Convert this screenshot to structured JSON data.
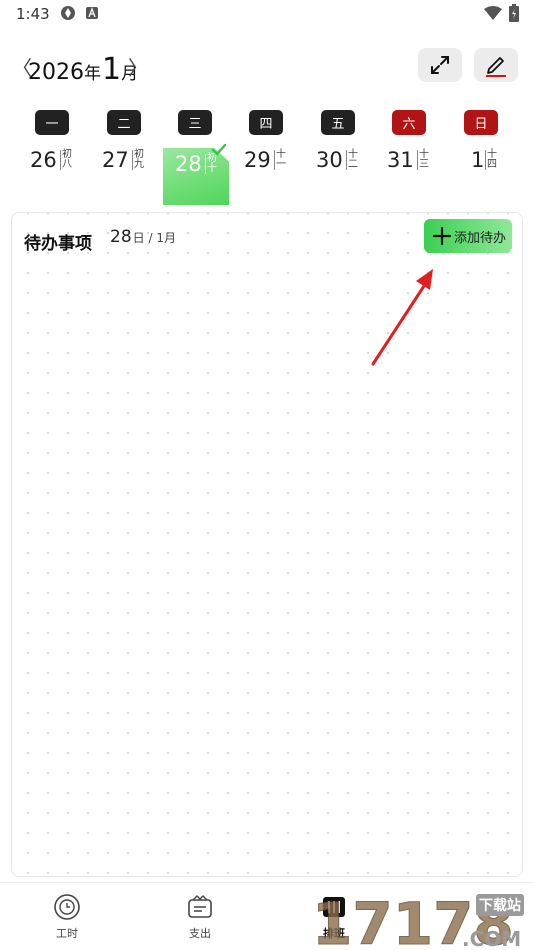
{
  "status_bar": {
    "time": "1:43"
  },
  "header": {
    "year": "2026",
    "year_suffix": "年",
    "month": "1",
    "month_suffix": "月",
    "prev_glyph": "〈",
    "next_glyph": "〉"
  },
  "week": {
    "days": [
      {
        "weekday": "一",
        "date": "26",
        "lunar": "初八",
        "weekend": false,
        "selected": false
      },
      {
        "weekday": "二",
        "date": "27",
        "lunar": "初九",
        "weekend": false,
        "selected": false
      },
      {
        "weekday": "三",
        "date": "28",
        "lunar": "初十",
        "weekend": false,
        "selected": true
      },
      {
        "weekday": "四",
        "date": "29",
        "lunar": "十一",
        "weekend": false,
        "selected": false
      },
      {
        "weekday": "五",
        "date": "30",
        "lunar": "十二",
        "weekend": false,
        "selected": false
      },
      {
        "weekday": "六",
        "date": "31",
        "lunar": "十三",
        "weekend": true,
        "selected": false
      },
      {
        "weekday": "日",
        "date": "1",
        "lunar": "十四",
        "weekend": true,
        "selected": false
      }
    ]
  },
  "todo": {
    "title": "待办事项",
    "date_day": "28",
    "date_suffix": "日 / 1月",
    "add_label": "添加待办"
  },
  "bottom_nav": {
    "items": [
      {
        "label": "工时",
        "icon": "clock-icon",
        "active": false
      },
      {
        "label": "支出",
        "icon": "wallet-icon",
        "active": false
      },
      {
        "label": "排班",
        "icon": "schedule-icon",
        "active": true
      }
    ]
  },
  "watermark": {
    "brand": "17178",
    "tag": "下载站"
  },
  "colors": {
    "accent_green": "#4fd55a",
    "weekend_red": "#b01414",
    "badge_dark": "#222222",
    "arrow_red": "#e02020"
  },
  "icons": {
    "expand": "expand-icon",
    "edit": "pen-icon",
    "check": "check-icon",
    "plus": "plus-icon"
  }
}
